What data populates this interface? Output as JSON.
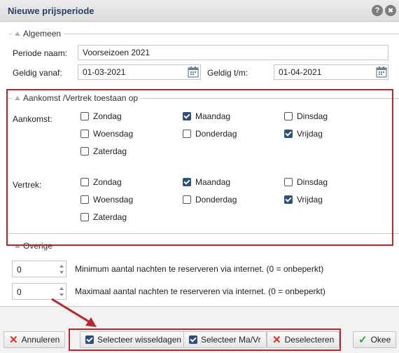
{
  "dialog": {
    "title": "Nieuwe prijsperiode",
    "help_glyph": "?",
    "close_glyph": "✖"
  },
  "general": {
    "legend": "Algemeen",
    "period_name_label": "Periode naam:",
    "period_name_value": "Voorseizoen 2021",
    "valid_from_label": "Geldig vanaf:",
    "valid_from_value": "01-03-2021",
    "valid_to_label": "Geldig t/m:",
    "valid_to_value": "01-04-2021"
  },
  "arrival_departure": {
    "legend": "Aankomst /Vertrek toestaan op",
    "arrival_label": "Aankomst:",
    "departure_label": "Vertrek:",
    "arrival_days": [
      {
        "label": "Zondag",
        "checked": false
      },
      {
        "label": "Maandag",
        "checked": true
      },
      {
        "label": "Dinsdag",
        "checked": false
      },
      {
        "label": "Woensdag",
        "checked": false
      },
      {
        "label": "Donderdag",
        "checked": false
      },
      {
        "label": "Vrijdag",
        "checked": true
      },
      {
        "label": "Zaterdag",
        "checked": false
      }
    ],
    "departure_days": [
      {
        "label": "Zondag",
        "checked": false
      },
      {
        "label": "Maandag",
        "checked": true
      },
      {
        "label": "Dinsdag",
        "checked": false
      },
      {
        "label": "Woensdag",
        "checked": false
      },
      {
        "label": "Donderdag",
        "checked": false
      },
      {
        "label": "Vrijdag",
        "checked": true
      },
      {
        "label": "Zaterdag",
        "checked": false
      }
    ]
  },
  "other": {
    "legend": "Overige",
    "min_nights_value": "0",
    "min_nights_text": "Minimum aantal nachten te reserveren via internet. (0 = onbeperkt)",
    "max_nights_value": "0",
    "max_nights_text": "Maximaal aantal nachten te reserveren via internet. (0 = onbeperkt)"
  },
  "footer": {
    "cancel_label": "Annuleren",
    "select_changeover_label": "Selecteer wisseldagen",
    "select_mon_fri_label": "Selecteer Ma/Vr",
    "deselect_label": "Deselecteren",
    "ok_label": "Okee"
  },
  "colors": {
    "highlight": "#b8262e",
    "accent": "#2e4f7a"
  }
}
